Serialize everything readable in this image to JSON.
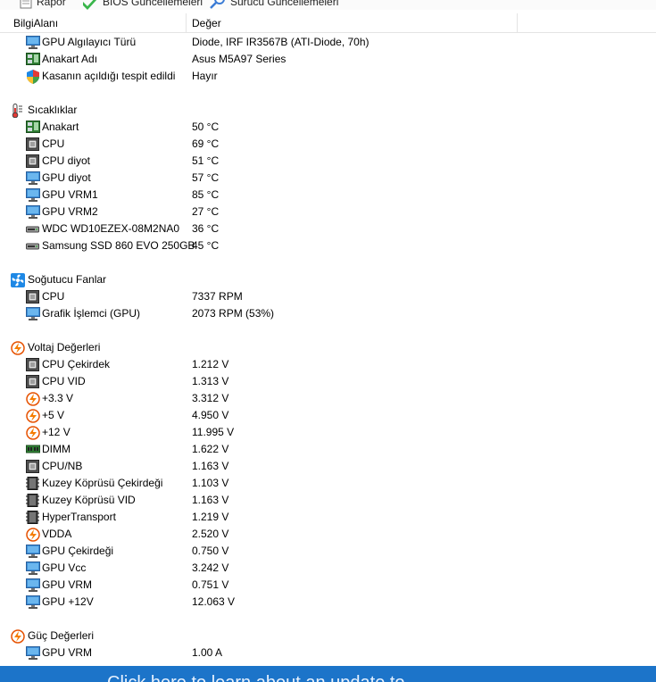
{
  "toolbar": {
    "report_label": "Rapor",
    "bios_label": "BIOS Güncellemeleri",
    "driver_label": "Sürücü Güncellemeleri"
  },
  "columns": {
    "field": "BilgiAlanı",
    "value": "Değer"
  },
  "top_items": [
    {
      "icon": "monitor-icon",
      "name": "GPU Algılayıcı Türü",
      "value": "Diode, IRF IR3567B  (ATI-Diode, 70h)"
    },
    {
      "icon": "motherboard-icon",
      "name": "Anakart Adı",
      "value": "Asus M5A97 Series"
    },
    {
      "icon": "shield-icon",
      "name": "Kasanın açıldığı tespit edildi",
      "value": "Hayır"
    }
  ],
  "groups": [
    {
      "icon": "thermometer-icon",
      "title": "Sıcaklıklar",
      "items": [
        {
          "icon": "motherboard-icon",
          "name": "Anakart",
          "value": "50 °C"
        },
        {
          "icon": "chip-icon",
          "name": "CPU",
          "value": "69 °C"
        },
        {
          "icon": "chip-icon",
          "name": "CPU diyot",
          "value": "51 °C"
        },
        {
          "icon": "monitor-icon",
          "name": "GPU diyot",
          "value": "57 °C"
        },
        {
          "icon": "monitor-icon",
          "name": "GPU VRM1",
          "value": "85 °C"
        },
        {
          "icon": "monitor-icon",
          "name": "GPU VRM2",
          "value": "27 °C"
        },
        {
          "icon": "drive-icon",
          "name": "WDC WD10EZEX-08M2NA0",
          "value": "36 °C"
        },
        {
          "icon": "drive-icon",
          "name": "Samsung SSD 860 EVO 250GB",
          "value": "45 °C"
        }
      ]
    },
    {
      "icon": "fan-icon",
      "title": "Soğutucu Fanlar",
      "items": [
        {
          "icon": "chip-icon",
          "name": "CPU",
          "value": "7337 RPM"
        },
        {
          "icon": "monitor-icon",
          "name": "Grafik İşlemci (GPU)",
          "value": "2073 RPM  (53%)"
        }
      ]
    },
    {
      "icon": "voltage-icon",
      "title": "Voltaj Değerleri",
      "items": [
        {
          "icon": "chip-icon",
          "name": "CPU Çekirdek",
          "value": "1.212 V"
        },
        {
          "icon": "chip-icon",
          "name": "CPU VID",
          "value": "1.313 V"
        },
        {
          "icon": "voltage-icon",
          "name": "+3.3 V",
          "value": "3.312 V"
        },
        {
          "icon": "voltage-icon",
          "name": "+5 V",
          "value": "4.950 V"
        },
        {
          "icon": "voltage-icon",
          "name": "+12 V",
          "value": "11.995 V"
        },
        {
          "icon": "ram-icon",
          "name": "DIMM",
          "value": "1.622 V"
        },
        {
          "icon": "chip-icon",
          "name": "CPU/NB",
          "value": "1.163 V"
        },
        {
          "icon": "northbridge-icon",
          "name": "Kuzey Köprüsü Çekirdeği",
          "value": "1.103 V"
        },
        {
          "icon": "northbridge-icon",
          "name": "Kuzey Köprüsü VID",
          "value": "1.163 V"
        },
        {
          "icon": "northbridge-icon",
          "name": "HyperTransport",
          "value": "1.219 V"
        },
        {
          "icon": "voltage-icon",
          "name": "VDDA",
          "value": "2.520 V"
        },
        {
          "icon": "monitor-icon",
          "name": "GPU Çekirdeği",
          "value": "0.750 V"
        },
        {
          "icon": "monitor-icon",
          "name": "GPU Vcc",
          "value": "3.242 V"
        },
        {
          "icon": "monitor-icon",
          "name": "GPU VRM",
          "value": "0.751 V"
        },
        {
          "icon": "monitor-icon",
          "name": "GPU +12V",
          "value": "12.063 V"
        }
      ]
    },
    {
      "icon": "voltage-icon",
      "title": "Güç Değerleri",
      "items": [
        {
          "icon": "monitor-icon",
          "name": "GPU VRM",
          "value": "1.00 A"
        }
      ]
    }
  ],
  "bottom_banner": "Click here to learn about an update to ..."
}
